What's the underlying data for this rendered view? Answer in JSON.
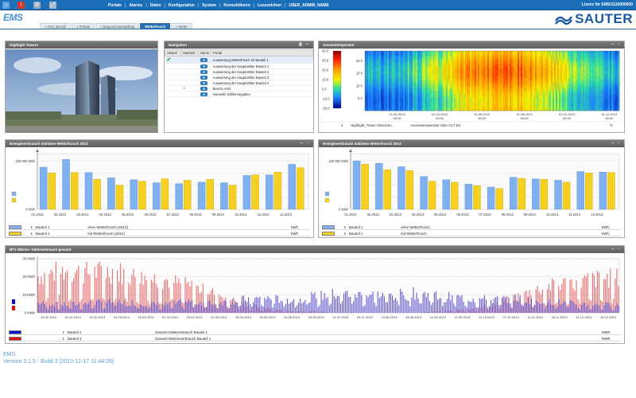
{
  "topbar": {
    "menu": [
      "Portale",
      "Alarms",
      "Daten",
      "Konfiguration",
      "System",
      "Konsolidieren",
      "Lesezeichen",
      "USER_ADMIN_NAME"
    ],
    "license": "Lizenz für EMS/1110000000"
  },
  "logo": {
    "ems": "EMS",
    "sauter": "SAUTER"
  },
  "breadcrumbs": [
    {
      "label": "« ASG_Benchi",
      "active": false
    },
    {
      "label": "« Portale",
      "active": false
    },
    {
      "label": "« Diagrammdarstellung",
      "active": false
    },
    {
      "label": "Wetterfrosch",
      "active": true
    },
    {
      "label": "« Werte",
      "active": false
    }
  ],
  "panels": {
    "highlight": {
      "title": "Highlight Towers"
    },
    "navigation": {
      "title": "Navigation",
      "columns": [
        "Aktuell",
        "Startseit",
        "Name",
        "Portal"
      ],
      "rows": [
        {
          "name": "Auswertung Wetterfrosch im Bauteil 1",
          "current": true,
          "home": false
        },
        {
          "name": "Auswertung der Hauptzähler Bauteil 1",
          "current": false,
          "home": false
        },
        {
          "name": "Auswertung der Hauptzähler Bauteil 2",
          "current": false,
          "home": false
        },
        {
          "name": "Auswertung der Hauptzähler Bauteil 3",
          "current": false,
          "home": false
        },
        {
          "name": "Auswertung der Hauptzähler Bauteil 4",
          "current": false,
          "home": false
        },
        {
          "name": "Benchi ASG",
          "current": false,
          "home": true
        },
        {
          "name": "manuelle Zählereingaben",
          "current": false,
          "home": false
        }
      ]
    },
    "heatmap": {
      "title": "Aussentemperatur",
      "scale": [
        "40,0",
        "30,0",
        "20,0",
        "10,0",
        "0,0",
        "-10,0",
        "-20,0"
      ],
      "yticks": [
        "20 h",
        "15 h",
        "10 h",
        "5 h"
      ],
      "xticks": [
        "01.02.2013",
        "01.04.2013",
        "01.06.2013",
        "01.08.2013",
        "01.10.2013",
        "01.12.2013"
      ],
      "xtime": "00:00",
      "info": {
        "num": "2",
        "object": "Highlight_Tower München",
        "desc": "Aussentemperatur über GLT B4",
        "unit": "°C"
      }
    },
    "energy2012": {
      "title": "Energieverbrauch mit/ohne Wetterfrosch 2012",
      "legend": [
        {
          "num": "1",
          "name": "Bauteil 1",
          "desc": "ohne Wetterfrosch (2012)",
          "unit": "kWh",
          "color": "#7fb0f0"
        },
        {
          "num": "1",
          "name": "Bauteil 1",
          "desc": "mit Wetterfrosch (2012)",
          "unit": "kWh",
          "color": "#f5d020"
        }
      ]
    },
    "energy2013": {
      "title": "Energieverbrauch mit/ohne Wetterfrosch 2013",
      "legend": [
        {
          "num": "1",
          "name": "Bauteil 1",
          "desc": "ohne Wetterfrosch",
          "unit": "kWh",
          "color": "#7fb0f0"
        },
        {
          "num": "1",
          "name": "Bauteil 1",
          "desc": "mit Wetterfrosch",
          "unit": "kWh",
          "color": "#f5d020"
        }
      ]
    },
    "daily": {
      "title": "BT1 Wärme- Kälteverbrauch gesamt",
      "legend": [
        {
          "num": "1",
          "name": "Bauteil 1",
          "desc": "Gesamt Kälteverbrauch Bauteil 1",
          "unit": "MWh",
          "color": "#0a0ad0"
        },
        {
          "num": "1",
          "name": "Bauteil 1",
          "desc": "Gesamt Wärmeverbrauch Bauteil 1",
          "unit": "MWh",
          "color": "#dd1111"
        }
      ]
    }
  },
  "footer": {
    "line1": "EMS",
    "line2": "Version 3.1.5 - Build 3 [2013-12-17 11:44:28]"
  },
  "chart_data": [
    {
      "type": "bar",
      "title": "Energieverbrauch mit/ohne Wetterfrosch 2012",
      "categories": [
        "01.2012",
        "02.2012",
        "03.2012",
        "04.2012",
        "05.2012",
        "06.2012",
        "07.2012",
        "08.2012",
        "09.2012",
        "10.2012",
        "11.2012",
        "12.2012"
      ],
      "yticks": [
        "100.000 kWh",
        "0 kWh"
      ],
      "ylim": [
        0,
        115000
      ],
      "series": [
        {
          "name": "ohne Wetterfrosch (2012)",
          "color": "#7fb0f0",
          "values": [
            87000,
            103000,
            76000,
            65000,
            61000,
            55000,
            53000,
            56000,
            55000,
            70000,
            71000,
            93000
          ]
        },
        {
          "name": "mit Wetterfrosch (2012)",
          "color": "#f5d020",
          "values": [
            75000,
            76000,
            62000,
            50000,
            58000,
            63000,
            60000,
            62000,
            50000,
            71000,
            77000,
            86000
          ]
        }
      ]
    },
    {
      "type": "bar",
      "title": "Energieverbrauch mit/ohne Wetterfrosch 2013",
      "categories": [
        "01.2013",
        "02.2013",
        "03.2013",
        "04.2013",
        "05.2013",
        "06.2013",
        "07.2013",
        "08.2013",
        "09.2013",
        "10.2013",
        "11.2013",
        "12.2013"
      ],
      "yticks": [
        "100.000 kWh",
        "0 kWh"
      ],
      "ylim": [
        0,
        115000
      ],
      "series": [
        {
          "name": "ohne Wetterfrosch",
          "color": "#7fb0f0",
          "values": [
            100000,
            95000,
            88000,
            68000,
            61000,
            52000,
            46000,
            66000,
            63000,
            60000,
            78000,
            77000
          ]
        },
        {
          "name": "mit Wetterfrosch",
          "color": "#f5d020",
          "values": [
            93000,
            82000,
            80000,
            58000,
            56000,
            49000,
            43000,
            64000,
            62000,
            56000,
            75000,
            76000
          ]
        }
      ]
    },
    {
      "type": "bar",
      "title": "BT1 Wärme- Kälteverbrauch gesamt",
      "x": [
        "15.01.2013",
        "01.02.2013",
        "14.02.2013",
        "01.03.2013",
        "16.03.2013",
        "01.04.2013",
        "15.04.2013",
        "01.05.2013",
        "15.05.2013",
        "30.05.2013",
        "14.06.2013",
        "29.06.2013",
        "14.07.2013",
        "29.07.2013",
        "13.08.2013",
        "28.08.2013",
        "12.09.2013",
        "27.09.2013",
        "12.10.2013",
        "27.10.2013",
        "11.11.2013",
        "26.11.2013",
        "11.12.2013",
        "26.12.2013"
      ],
      "yticks": [
        "30 MWh",
        "20 MWh",
        "10 MWh",
        "0 MWh"
      ],
      "ylim": [
        0,
        30
      ],
      "series": [
        {
          "name": "Gesamt Kälteverbrauch Bauteil 1",
          "color": "#0a0ad0",
          "values": [
            6,
            5,
            6,
            7,
            6,
            5,
            7,
            6,
            8,
            9,
            8,
            10,
            12,
            11,
            11,
            12,
            10,
            9,
            8,
            9,
            7,
            6,
            5,
            5
          ]
        },
        {
          "name": "Gesamt Wärmeverbrauch Bauteil 1",
          "color": "#dd1111",
          "values": [
            22,
            25,
            24,
            25,
            21,
            20,
            16,
            12,
            6,
            3,
            1,
            1,
            0,
            0,
            0,
            0,
            1,
            2,
            5,
            10,
            15,
            18,
            20,
            21
          ]
        }
      ]
    },
    {
      "type": "heatmap",
      "title": "Aussentemperatur",
      "x_range": [
        "01.01.2013",
        "31.12.2013"
      ],
      "y_range_h": [
        0,
        24
      ],
      "color_range": [
        -20,
        40
      ],
      "pattern": "cool (blue/green) in winter months, warm (orange/red) in summer, warmest in afternoon hours"
    }
  ]
}
